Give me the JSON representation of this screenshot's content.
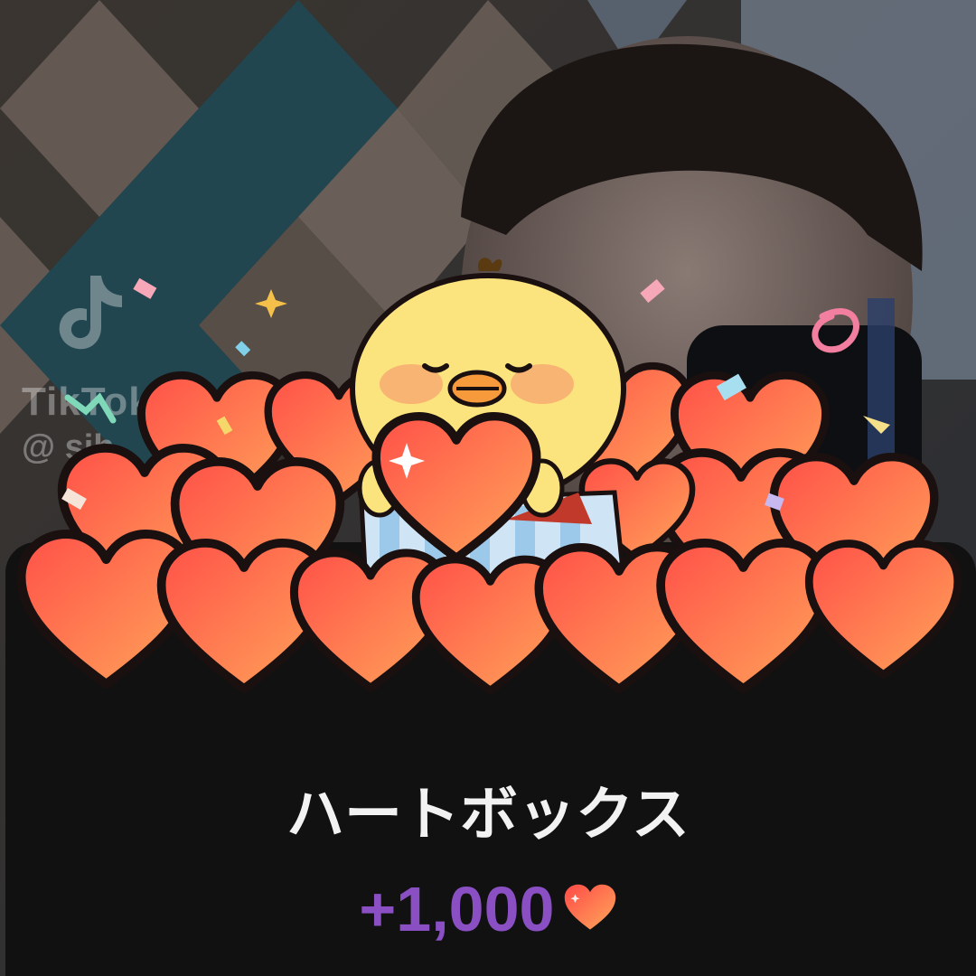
{
  "background": {
    "watermark_name": "TikTok",
    "watermark_handle": "@ sih",
    "icon": "tiktok-logo-icon"
  },
  "popup": {
    "title": "ハートボックス",
    "amount": "+1,000",
    "amount_icon": "heart-icon"
  },
  "colors": {
    "panel": "#111111",
    "title": "#f2f2f2",
    "amount": "#8a4fc2",
    "heart_top": "#ff5a4a",
    "heart_bottom": "#ffa057",
    "chick": "#fbe37e"
  }
}
